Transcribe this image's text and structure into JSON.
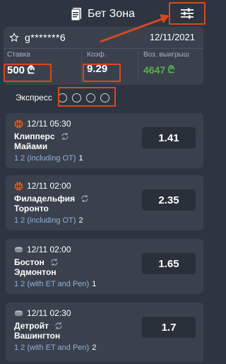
{
  "header": {
    "title": "Бет Зона",
    "doc_icon": "document-icon",
    "settings_icon": "sliders-icon"
  },
  "card": {
    "star_icon": "star-icon",
    "user": "g*******6",
    "date": "12/11/2021",
    "stake": {
      "label": "Ставка",
      "value": "500",
      "currency": "₾"
    },
    "coef": {
      "label": "Коэф.",
      "value": "9.29"
    },
    "win": {
      "label": "Воз. выигрыш",
      "value": "4647",
      "currency": "₾"
    }
  },
  "express": {
    "label": "Экспресс",
    "circles": 4
  },
  "bets": [
    {
      "time": "12/11 05:30",
      "team1": "Клипперс",
      "team2": "Майами",
      "market": "1 2 (including OT)",
      "selection": "1",
      "odds": "1.41",
      "sport_icon": "basketball-icon"
    },
    {
      "time": "12/11 02:00",
      "team1": "Филадельфия",
      "team2": "Торонто",
      "market": "1 2 (including OT)",
      "selection": "2",
      "odds": "2.35",
      "sport_icon": "basketball-icon"
    },
    {
      "time": "12/11 02:00",
      "team1": "Бостон",
      "team2": "Эдмонтон",
      "market": "1 2 (with ET and Pen)",
      "selection": "1",
      "odds": "1.65",
      "sport_icon": "hockey-puck-icon"
    },
    {
      "time": "12/11 02:30",
      "team1": "Детройт",
      "team2": "Вашингтон",
      "market": "1 2 (with ET and Pen)",
      "selection": "2",
      "odds": "1.7",
      "sport_icon": "hockey-puck-icon"
    }
  ],
  "colors": {
    "background": "#2f3540",
    "card": "#3a414d",
    "accent_red": "#d9471f",
    "win_green": "#56b04b",
    "market_blue": "#8fb0d6"
  }
}
